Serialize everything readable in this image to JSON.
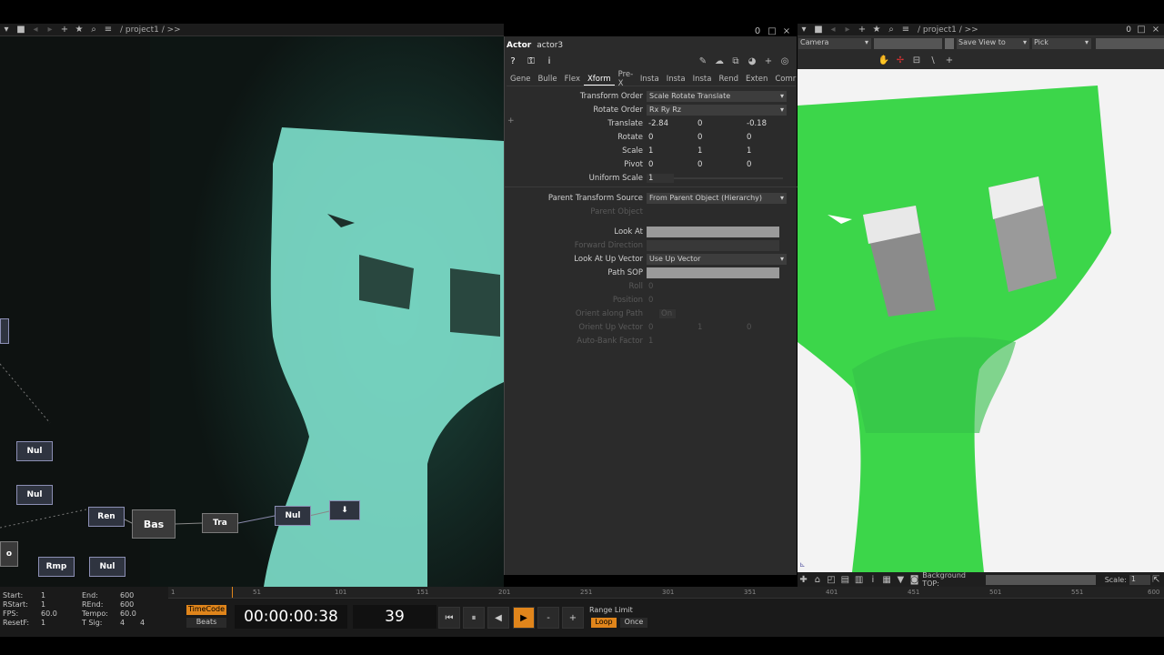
{
  "left_pane": {
    "path": "/ project1 / >>"
  },
  "right_pane": {
    "path": "/ project1 / >>",
    "camera": "Camera",
    "save_view": "Save View to",
    "pick": "Pick",
    "background_label": "Background TOP:",
    "scale_label": "Scale:",
    "scale_value": "1",
    "pane_num": "0"
  },
  "param": {
    "op_type": "Actor",
    "op_name": "actor3",
    "tabs": [
      "Gene",
      "Bulle",
      "Flex",
      "Xform",
      "Pre-X",
      "Insta",
      "Insta",
      "Insta",
      "Rend",
      "Exten",
      "Comr"
    ],
    "active_tab": "Xform",
    "transform_order_label": "Transform Order",
    "transform_order": "Scale Rotate Translate",
    "rotate_order_label": "Rotate Order",
    "rotate_order": "Rx Ry Rz",
    "translate_label": "Translate",
    "translate": [
      "-2.84",
      "0",
      "-0.18"
    ],
    "rotate_label": "Rotate",
    "rotate": [
      "0",
      "0",
      "0"
    ],
    "scale_label": "Scale",
    "scale": [
      "1",
      "1",
      "1"
    ],
    "pivot_label": "Pivot",
    "pivot": [
      "0",
      "0",
      "0"
    ],
    "uniform_scale_label": "Uniform Scale",
    "uniform_scale": "1",
    "parent_src_label": "Parent Transform Source",
    "parent_src": "From Parent Object (Hierarchy)",
    "parent_object_label": "Parent Object",
    "look_at_label": "Look At",
    "forward_dir_label": "Forward Direction",
    "look_up_label": "Look At Up Vector",
    "look_up": "Use Up Vector",
    "path_sop_label": "Path SOP",
    "roll_label": "Roll",
    "roll": "0",
    "position_label": "Position",
    "position": "0",
    "orient_label": "Orient along Path",
    "orient": "On",
    "orient_up_label": "Orient Up Vector",
    "orient_up": [
      "0",
      "1",
      "0"
    ],
    "auto_bank_label": "Auto-Bank Factor",
    "auto_bank": "1"
  },
  "nodes": [
    "Nul",
    "Nul",
    "Ren",
    "Bas",
    "Tra",
    "Nul",
    "Rmp",
    "Nul"
  ],
  "timeline": {
    "ticks": [
      "1",
      "51",
      "101",
      "151",
      "201",
      "251",
      "301",
      "351",
      "401",
      "451",
      "501",
      "551",
      "600"
    ],
    "start_label": "Start:",
    "start": "1",
    "rstart_label": "RStart:",
    "rstart": "1",
    "fps_label": "FPS:",
    "fps": "60.0",
    "resetf_label": "ResetF:",
    "resetf": "1",
    "end_label": "End:",
    "end": "600",
    "rend_label": "REnd:",
    "rend": "600",
    "tempo_label": "Tempo:",
    "tempo": "60.0",
    "tsig_label": "T Sig:",
    "tsig_a": "4",
    "tsig_b": "4",
    "timecode_label": "TimeCode",
    "beats_label": "Beats",
    "timecode": "00:00:00:38",
    "frame": "39",
    "range_limit": "Range Limit",
    "loop": "Loop",
    "once": "Once"
  },
  "colors": {
    "accent": "#e0851b",
    "green": "#3cd64a",
    "cyan": "#8df0dc"
  }
}
